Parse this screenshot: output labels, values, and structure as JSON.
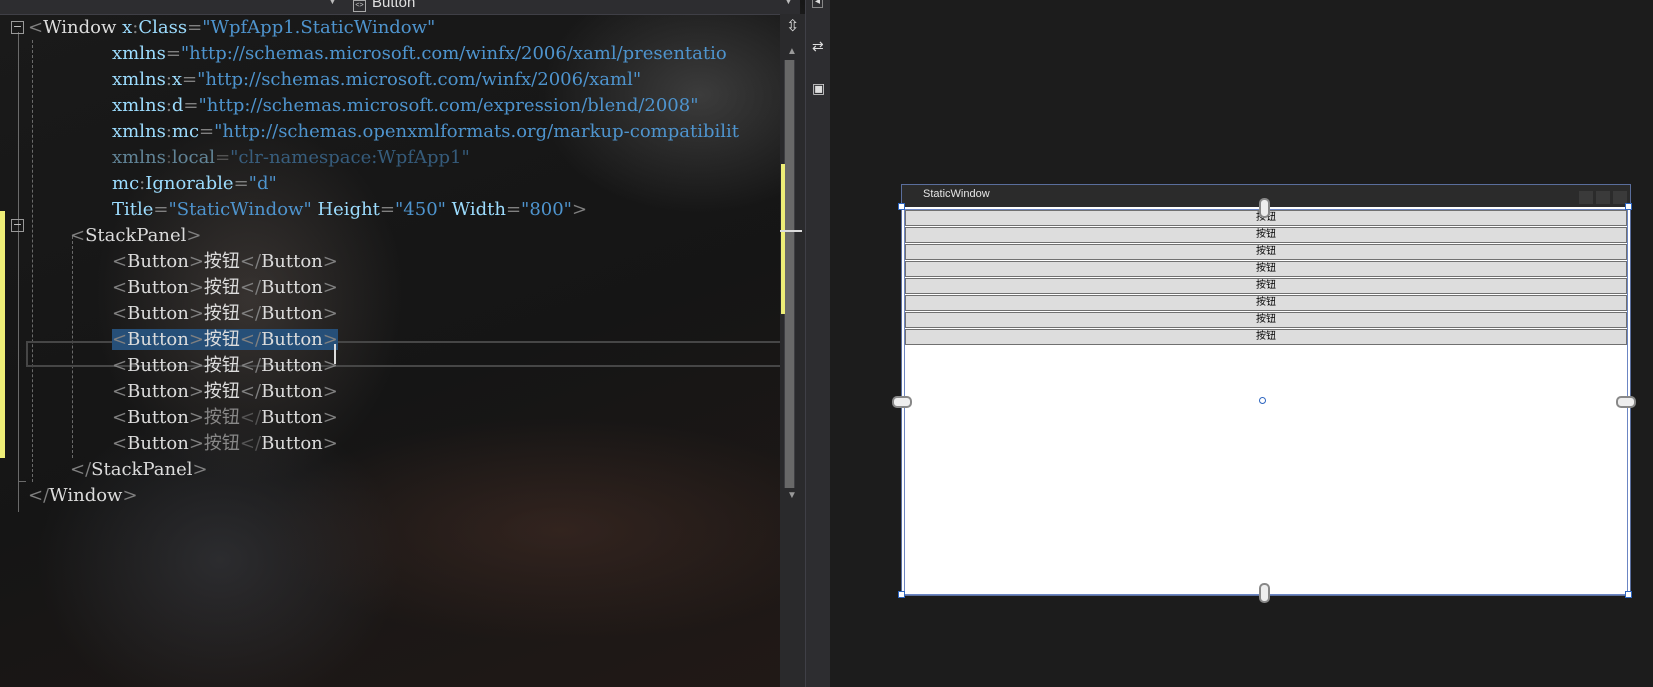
{
  "topbar": {
    "combo_label": "Button"
  },
  "xaml_lines": [
    [
      [
        "b",
        "<"
      ],
      [
        "e",
        "Window"
      ],
      [
        "a",
        " x"
      ],
      [
        "b",
        ":"
      ],
      [
        "a",
        "Class"
      ],
      [
        "b",
        "="
      ],
      [
        "v",
        "\"WpfApp1.StaticWindow\""
      ]
    ],
    [
      [
        "a",
        "xmlns"
      ],
      [
        "b",
        "="
      ],
      [
        "v",
        "\"http://schemas.microsoft.com/winfx/2006/xaml/presentatio"
      ]
    ],
    [
      [
        "a",
        "xmlns"
      ],
      [
        "b",
        ":"
      ],
      [
        "a",
        "x"
      ],
      [
        "b",
        "="
      ],
      [
        "v",
        "\"http://schemas.microsoft.com/winfx/2006/xaml\""
      ]
    ],
    [
      [
        "a",
        "xmlns"
      ],
      [
        "b",
        ":"
      ],
      [
        "a",
        "d"
      ],
      [
        "b",
        "="
      ],
      [
        "v",
        "\"http://schemas.microsoft.com/expression/blend/2008\""
      ]
    ],
    [
      [
        "a",
        "xmlns"
      ],
      [
        "b",
        ":"
      ],
      [
        "a",
        "mc"
      ],
      [
        "b",
        "="
      ],
      [
        "v",
        "\"http://schemas.openxmlformats.org/markup-compatibilit"
      ]
    ],
    [
      [
        "a",
        "xmlns"
      ],
      [
        "b",
        ":"
      ],
      [
        "a",
        "local"
      ],
      [
        "b",
        "="
      ],
      [
        "v",
        "\"clr-namespace:WpfApp1\""
      ]
    ],
    [
      [
        "a",
        "mc"
      ],
      [
        "b",
        ":"
      ],
      [
        "a",
        "Ignorable"
      ],
      [
        "b",
        "="
      ],
      [
        "v",
        "\"d\""
      ]
    ],
    [
      [
        "a",
        "Title"
      ],
      [
        "b",
        "="
      ],
      [
        "v",
        "\"StaticWindow\""
      ],
      [
        "a",
        " Height"
      ],
      [
        "b",
        "="
      ],
      [
        "v",
        "\"450\""
      ],
      [
        "a",
        " Width"
      ],
      [
        "b",
        "="
      ],
      [
        "v",
        "\"800\""
      ],
      [
        "b",
        ">"
      ]
    ],
    [
      [
        "b",
        "<"
      ],
      [
        "e",
        "StackPanel"
      ],
      [
        "b",
        ">"
      ]
    ],
    [
      [
        "b",
        "<"
      ],
      [
        "e",
        "Button"
      ],
      [
        "b",
        ">"
      ],
      [
        "t",
        "按钮"
      ],
      [
        "b",
        "</"
      ],
      [
        "e",
        "Button"
      ],
      [
        "b",
        ">"
      ]
    ],
    [
      [
        "b",
        "<"
      ],
      [
        "e",
        "Button"
      ],
      [
        "b",
        ">"
      ],
      [
        "t",
        "按钮"
      ],
      [
        "b",
        "</"
      ],
      [
        "e",
        "Button"
      ],
      [
        "b",
        ">"
      ]
    ],
    [
      [
        "b",
        "<"
      ],
      [
        "e",
        "Button"
      ],
      [
        "b",
        ">"
      ],
      [
        "t",
        "按钮"
      ],
      [
        "b",
        "</"
      ],
      [
        "e",
        "Button"
      ],
      [
        "b",
        ">"
      ]
    ],
    [
      [
        "b",
        "<"
      ],
      [
        "e",
        "Button"
      ],
      [
        "b",
        ">"
      ],
      [
        "t",
        "按钮"
      ],
      [
        "b",
        "</"
      ],
      [
        "e",
        "Button"
      ],
      [
        "b",
        ">"
      ]
    ],
    [
      [
        "b",
        "<"
      ],
      [
        "e",
        "Button"
      ],
      [
        "b",
        ">"
      ],
      [
        "t",
        "按钮"
      ],
      [
        "b",
        "</"
      ],
      [
        "e",
        "Button"
      ],
      [
        "b",
        ">"
      ]
    ],
    [
      [
        "b",
        "<"
      ],
      [
        "e",
        "Button"
      ],
      [
        "b",
        ">"
      ],
      [
        "t",
        "按钮"
      ],
      [
        "b",
        "</"
      ],
      [
        "e",
        "Button"
      ],
      [
        "b",
        ">"
      ]
    ],
    [
      [
        "b",
        "<"
      ],
      [
        "e",
        "Button"
      ],
      [
        "b",
        ">"
      ],
      [
        "t",
        "按钮"
      ],
      [
        "b",
        "</"
      ],
      [
        "e",
        "Button"
      ],
      [
        "b",
        ">"
      ]
    ],
    [
      [
        "b",
        "<"
      ],
      [
        "e",
        "Button"
      ],
      [
        "b",
        ">"
      ],
      [
        "t",
        "按钮"
      ],
      [
        "b",
        "</"
      ],
      [
        "e",
        "Button"
      ],
      [
        "b",
        ">"
      ]
    ],
    [
      [
        "b",
        "</"
      ],
      [
        "e",
        "StackPanel"
      ],
      [
        "b",
        ">"
      ]
    ],
    [
      [
        "b",
        "</"
      ],
      [
        "e",
        "Window"
      ],
      [
        "b",
        ">"
      ]
    ]
  ],
  "designer": {
    "window_title": "StaticWindow",
    "buttons": [
      "按钮",
      "按钮",
      "按钮",
      "按钮",
      "按钮",
      "按钮",
      "按钮",
      "按钮"
    ]
  },
  "colors": {
    "xaml_bracket": "#808080",
    "xaml_element": "#dcdcdc",
    "xaml_attribute": "#9cdcfe",
    "xaml_value": "#4e94ce",
    "selection": "#264f78",
    "change_marker": "#eeee77",
    "design_button_bg": "#dddddd",
    "design_title_bar": "#2b2b2b"
  },
  "icons": [
    "split-icon",
    "swap-panes-icon",
    "pane-layout-icon",
    "collapse-icon",
    "combo-element-icon"
  ]
}
